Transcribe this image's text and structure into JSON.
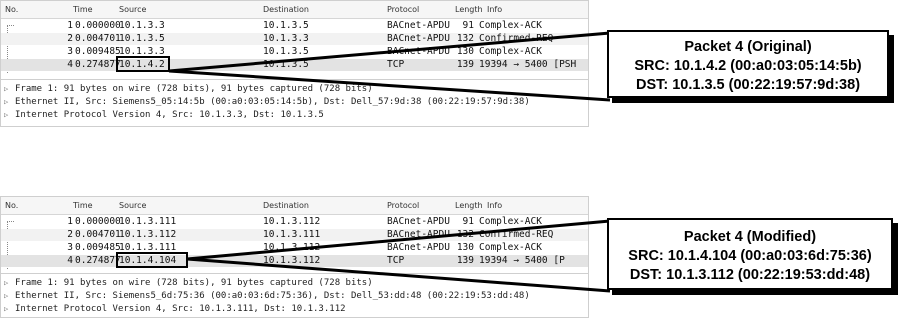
{
  "headers": {
    "no": "No.",
    "time": "Time",
    "source": "Source",
    "destination": "Destination",
    "protocol": "Protocol",
    "length": "Length",
    "info": "Info"
  },
  "top": {
    "packets": [
      {
        "no": "1",
        "time": "0.000000",
        "source": "10.1.3.3",
        "destination": "10.1.3.5",
        "protocol": "BACnet-APDU",
        "length": "91",
        "info": "Complex-ACK"
      },
      {
        "no": "2",
        "time": "0.004701",
        "source": "10.1.3.5",
        "destination": "10.1.3.3",
        "protocol": "BACnet-APDU",
        "length": "132",
        "info": "Confirmed-REQ"
      },
      {
        "no": "3",
        "time": "0.009485",
        "source": "10.1.3.3",
        "destination": "10.1.3.5",
        "protocol": "BACnet-APDU",
        "length": "130",
        "info": "Complex-ACK"
      },
      {
        "no": "4",
        "time": "0.274877",
        "source": "10.1.4.2",
        "destination": "10.1.3.5",
        "protocol": "TCP",
        "length": "139",
        "info": "19394 → 5400 [PSH"
      }
    ],
    "details": [
      "Frame 1: 91 bytes on wire (728 bits), 91 bytes captured (728 bits)",
      "Ethernet II, Src: Siemens5_05:14:5b (00:a0:03:05:14:5b), Dst: Dell_57:9d:38 (00:22:19:57:9d:38)",
      "Internet Protocol Version 4, Src: 10.1.3.3, Dst: 10.1.3.5"
    ],
    "annotation": {
      "title": "Packet 4 (Original)",
      "src": "SRC: 10.1.4.2 (00:a0:03:05:14:5b)",
      "dst": "DST: 10.1.3.5 (00:22:19:57:9d:38)"
    }
  },
  "bottom": {
    "packets": [
      {
        "no": "1",
        "time": "0.000000",
        "source": "10.1.3.111",
        "destination": "10.1.3.112",
        "protocol": "BACnet-APDU",
        "length": "91",
        "info": "Complex-ACK"
      },
      {
        "no": "2",
        "time": "0.004701",
        "source": "10.1.3.112",
        "destination": "10.1.3.111",
        "protocol": "BACnet-APDU",
        "length": "132",
        "info": "Confirmed-REQ"
      },
      {
        "no": "3",
        "time": "0.009485",
        "source": "10.1.3.111",
        "destination": "10.1.3.112",
        "protocol": "BACnet-APDU",
        "length": "130",
        "info": "Complex-ACK"
      },
      {
        "no": "4",
        "time": "0.274877",
        "source": "10.1.4.104",
        "destination": "10.1.3.112",
        "protocol": "TCP",
        "length": "139",
        "info": "19394 → 5400 [P"
      }
    ],
    "details": [
      "Frame 1: 91 bytes on wire (728 bits), 91 bytes captured (728 bits)",
      "Ethernet II, Src: Siemens5_6d:75:36 (00:a0:03:6d:75:36), Dst: Dell_53:dd:48 (00:22:19:53:dd:48)",
      "Internet Protocol Version 4, Src: 10.1.3.111, Dst: 10.1.3.112"
    ],
    "annotation": {
      "title": "Packet 4 (Modified)",
      "src": "SRC: 10.1.4.104 (00:a0:03:6d:75:36)",
      "dst": "DST: 10.1.3.112 (00:22:19:53:dd:48)"
    }
  }
}
